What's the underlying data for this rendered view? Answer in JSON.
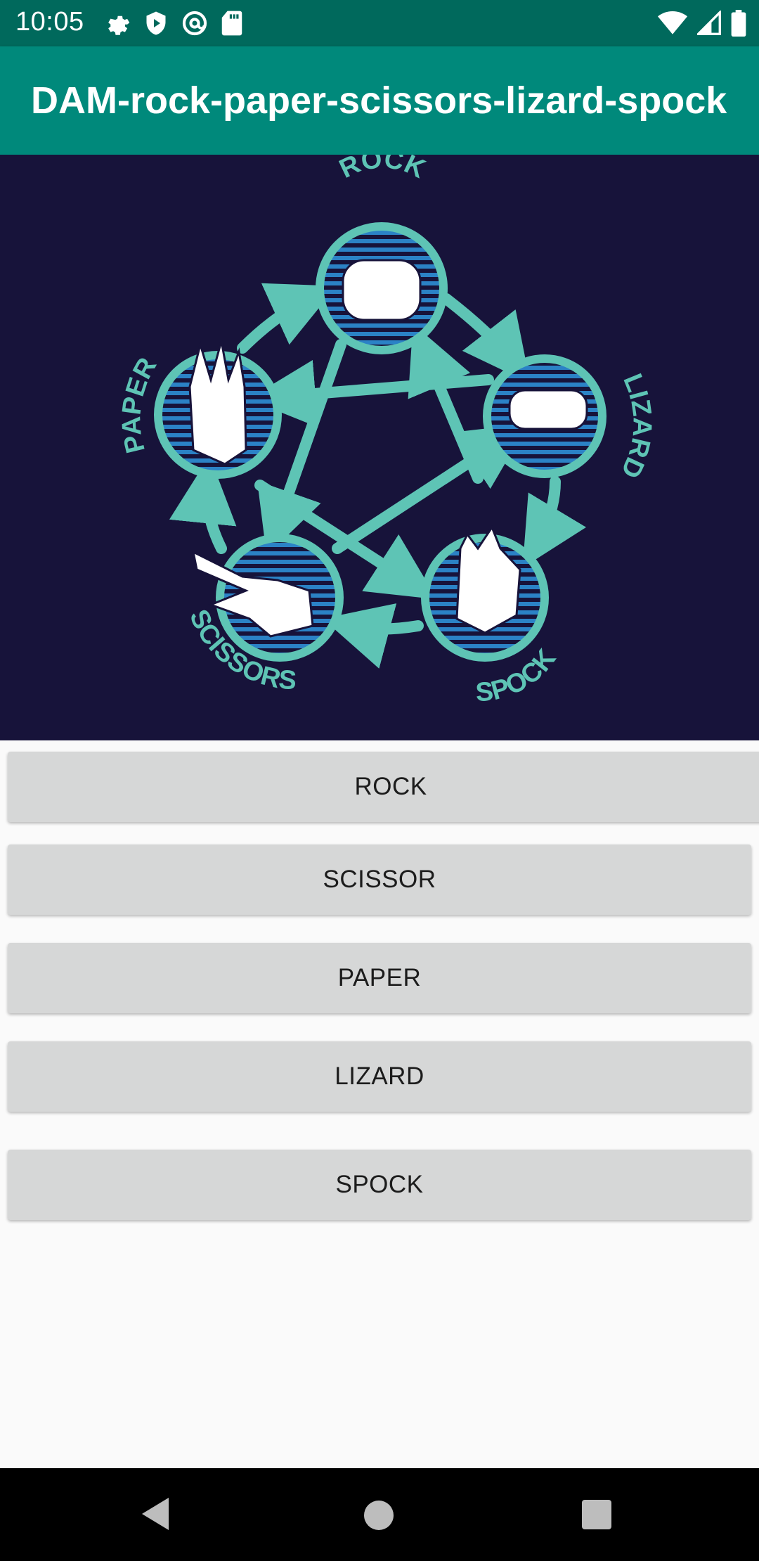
{
  "status_bar": {
    "time": "10:05",
    "left_icons": [
      "gear-icon",
      "shield-play-icon",
      "at-sync-icon",
      "sd-card-icon"
    ],
    "right_icons": [
      "wifi-icon",
      "signal-icon",
      "battery-icon"
    ]
  },
  "app_bar": {
    "title": "DAM-rock-paper-scissors-lizard-spock",
    "color": "#00897b"
  },
  "hero": {
    "background": "#17133a",
    "accent": "#5ec4b5",
    "labels": {
      "rock": "ROCK",
      "lizard": "LIZARD",
      "spock": "SPOCK",
      "scissors": "SCISSORS",
      "paper": "PAPER"
    }
  },
  "buttons": {
    "rock": "ROCK",
    "scissor": "SCISSOR",
    "paper": "PAPER",
    "lizard": "LIZARD",
    "spock": "SPOCK"
  },
  "nav_bar": {
    "icons": [
      "back-icon",
      "home-icon",
      "recents-icon"
    ]
  }
}
